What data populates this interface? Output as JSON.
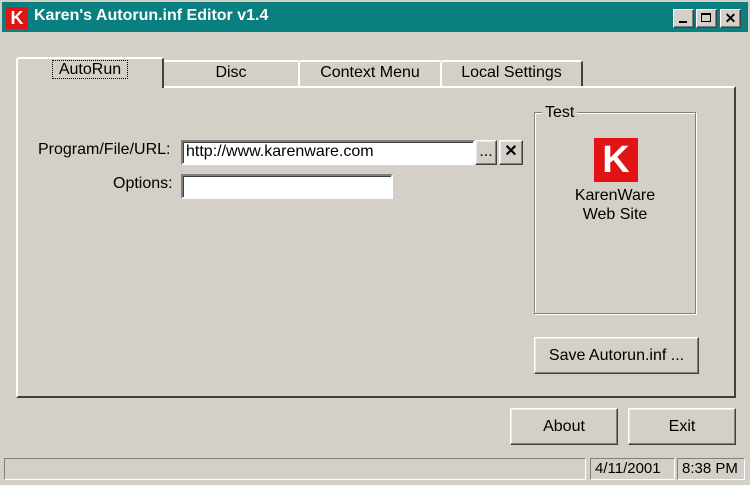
{
  "window": {
    "title": "Karen's Autorun.inf Editor v1.4",
    "icon_letter": "K"
  },
  "tabs": [
    {
      "label": "AutoRun",
      "active": true
    },
    {
      "label": "Disc",
      "active": false
    },
    {
      "label": "Context Menu",
      "active": false
    },
    {
      "label": "Local Settings",
      "active": false
    }
  ],
  "autorun": {
    "program_label": "Program/File/URL:",
    "program_value": "http://www.karenware.com",
    "browse_label": "...",
    "clear_label": "✕",
    "options_label": "Options:",
    "options_value": ""
  },
  "test_group": {
    "title": "Test",
    "logo_letter": "K",
    "line1": "KarenWare",
    "line2": "Web Site"
  },
  "buttons": {
    "save": "Save Autorun.inf ...",
    "about": "About",
    "exit": "Exit"
  },
  "status": {
    "date": "4/11/2001",
    "time": "8:38 PM"
  },
  "colors": {
    "titlebar": "#0a7f7f",
    "logo": "#e01414",
    "face": "#d4d0c8"
  }
}
